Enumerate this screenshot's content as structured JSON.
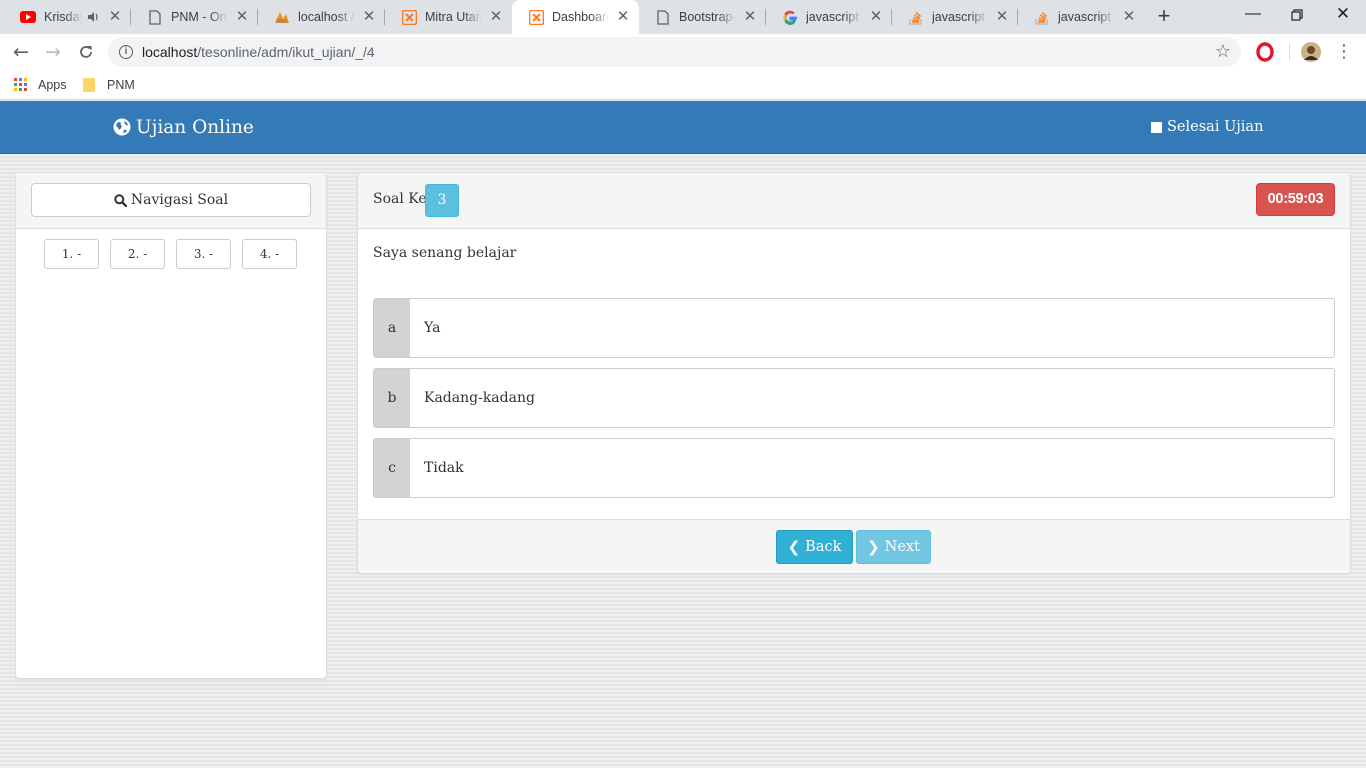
{
  "browser": {
    "tabs": [
      {
        "title": "Krisday",
        "icon": "youtube-icon",
        "audio": true
      },
      {
        "title": "PNM - Onli",
        "icon": "page-icon"
      },
      {
        "title": "localhost /",
        "icon": "phpmyadmin-icon"
      },
      {
        "title": "Mitra Utam",
        "icon": "xampp-icon"
      },
      {
        "title": "Dashboard",
        "icon": "xampp-icon",
        "active": true
      },
      {
        "title": "Bootstrap-n",
        "icon": "page-icon"
      },
      {
        "title": "javascript a",
        "icon": "google-icon"
      },
      {
        "title": "javascript -",
        "icon": "stackoverflow-icon"
      },
      {
        "title": "javascript -",
        "icon": "stackoverflow-icon"
      }
    ],
    "url_host": "localhost",
    "url_path": "/tesonline/adm/ikut_ujian/_/4",
    "bookmarks": [
      {
        "label": "Apps",
        "icon": "apps-grid-icon"
      },
      {
        "label": "PNM",
        "icon": "folder-icon"
      }
    ]
  },
  "navbar": {
    "brand": "Ujian Online",
    "finish_label": "Selesai Ujian",
    "color": "#337ab7"
  },
  "sidebar": {
    "nav_button_label": "Navigasi Soal",
    "questions": [
      "1. -",
      "2. -",
      "3. -",
      "4. -"
    ]
  },
  "exam": {
    "soal_label": "Soal Ke",
    "soal_number": "3",
    "timer": "00:59:03",
    "question": "Saya senang belajar",
    "options": [
      {
        "key": "a",
        "text": "Ya"
      },
      {
        "key": "b",
        "text": "Kadang-kadang"
      },
      {
        "key": "c",
        "text": "Tidak"
      }
    ],
    "back_label": "Back",
    "next_label": "Next"
  }
}
